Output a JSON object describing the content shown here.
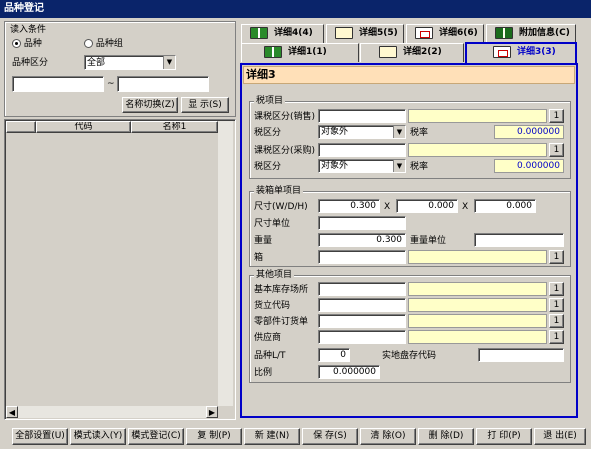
{
  "window": {
    "title": "品种登记"
  },
  "search": {
    "group_label": "读入条件",
    "radio_product": "品种",
    "radio_group": "品种组",
    "category_label": "品种区分",
    "category_value": "全部",
    "range_sep": "~",
    "name_switch_button": "名称切换(Z)",
    "display_button": "显 示(S)"
  },
  "list": {
    "col_code": "代码",
    "col_name": "名称1"
  },
  "tabs": {
    "row1": [
      {
        "label": "详细4(4)"
      },
      {
        "label": "详细5(5)"
      },
      {
        "label": "详细6(6)"
      },
      {
        "label": "附加信息(C)"
      }
    ],
    "row2": [
      {
        "label": "详细1(1)"
      },
      {
        "label": "详细2(2)"
      },
      {
        "label": "详细3(3)"
      }
    ]
  },
  "detail": {
    "header": "详细3",
    "tax": {
      "legend": "税项目",
      "tax_class_sales_label": "课税区分(销售)",
      "tax_zone_label_1": "税区分",
      "tax_zone_value_1": "对象外",
      "tax_rate_label_1": "税率",
      "tax_rate_value_1": "0.000000",
      "tax_class_purchase_label": "课税区分(采购)",
      "tax_zone_label_2": "税区分",
      "tax_zone_value_2": "对象外",
      "tax_rate_label_2": "税率",
      "tax_rate_value_2": "0.000000",
      "lookup": "1"
    },
    "packing": {
      "legend": "装箱单项目",
      "size_label": "尺寸(W/D/H)",
      "size_w": "0.300",
      "size_d": "0.000",
      "size_h": "0.000",
      "times": "X",
      "size_unit_label": "尺寸单位",
      "weight_label": "重量",
      "weight_value": "0.300",
      "weight_unit_label": "重量单位",
      "box_label": "箱",
      "lookup": "1"
    },
    "other": {
      "legend": "其他项目",
      "warehouse_label": "基本库存场所",
      "supplier_code_label": "货立代码",
      "parts_order_label": "零部件订货单",
      "vendor_label": "供应商",
      "lt_label": "品种L/T",
      "lt_value": "0",
      "stock_code_label": "实地盘存代码",
      "ratio_label": "比例",
      "ratio_value": "0.000000",
      "lookup": "1"
    }
  },
  "toolbar": {
    "buttons": [
      "全部设置(U)",
      "模式读入(Y)",
      "模式登记(C)",
      "复 制(P)",
      "新 建(N)",
      "保 存(S)",
      "清 除(O)",
      "删 除(D)",
      "打 印(P)",
      "退 出(E)"
    ]
  }
}
